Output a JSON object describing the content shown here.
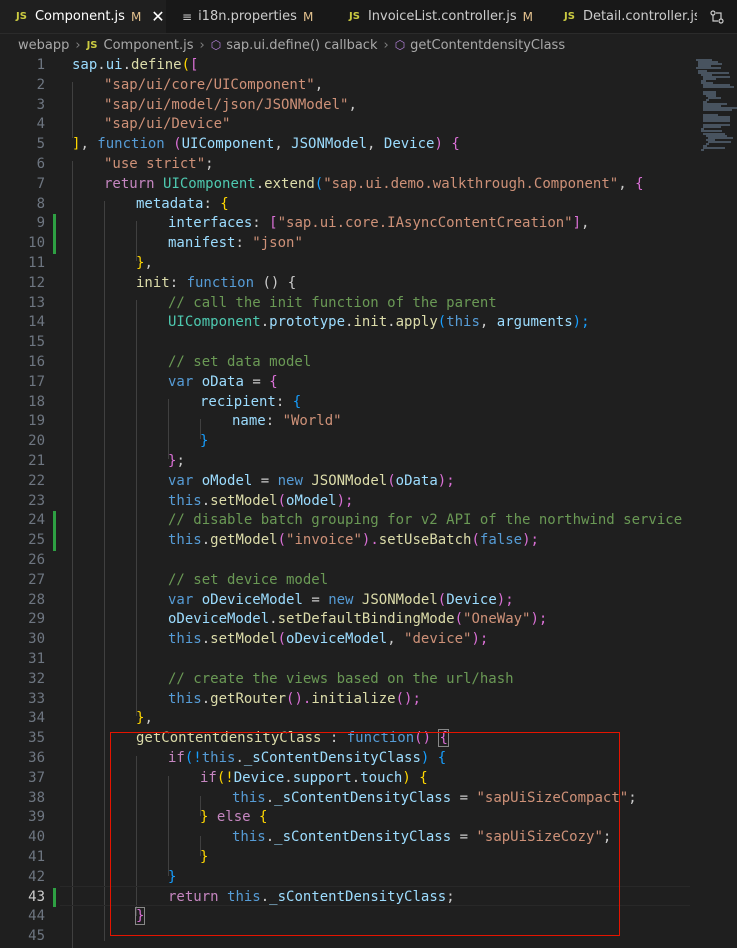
{
  "tabs": [
    {
      "icon": "JS",
      "label": "Component.js",
      "status": "M",
      "active": true,
      "close": "✕"
    },
    {
      "icon": "≡",
      "label": "i18n.properties",
      "status": "M",
      "active": false
    },
    {
      "icon": "JS",
      "label": "InvoiceList.controller.js",
      "status": "M",
      "active": false
    },
    {
      "icon": "JS",
      "label": "Detail.controller.js",
      "status": "",
      "active": false
    }
  ],
  "breadcrumb": {
    "folder": "webapp",
    "file_icon": "JS",
    "file": "Component.js",
    "symbol1": "sap.ui.define() callback",
    "symbol2": "getContentdensityClass"
  },
  "icons": {
    "tab_actions": "split-compare-icon",
    "cube": "method-cube-icon"
  },
  "editor": {
    "current_line": 43,
    "lines": [
      {
        "n": "1"
      },
      {
        "n": "2"
      },
      {
        "n": "3"
      },
      {
        "n": "4"
      },
      {
        "n": "5"
      },
      {
        "n": "6"
      },
      {
        "n": "7"
      },
      {
        "n": "8"
      },
      {
        "n": "9"
      },
      {
        "n": "10"
      },
      {
        "n": "11"
      },
      {
        "n": "12"
      },
      {
        "n": "13"
      },
      {
        "n": "14"
      },
      {
        "n": "15"
      },
      {
        "n": "16"
      },
      {
        "n": "17"
      },
      {
        "n": "18"
      },
      {
        "n": "19"
      },
      {
        "n": "20"
      },
      {
        "n": "21"
      },
      {
        "n": "22"
      },
      {
        "n": "23"
      },
      {
        "n": "24"
      },
      {
        "n": "25"
      },
      {
        "n": "26"
      },
      {
        "n": "27"
      },
      {
        "n": "28"
      },
      {
        "n": "29"
      },
      {
        "n": "30"
      },
      {
        "n": "31"
      },
      {
        "n": "32"
      },
      {
        "n": "33"
      },
      {
        "n": "34"
      },
      {
        "n": "35"
      },
      {
        "n": "36"
      },
      {
        "n": "37"
      },
      {
        "n": "38"
      },
      {
        "n": "39"
      },
      {
        "n": "40"
      },
      {
        "n": "41"
      },
      {
        "n": "42"
      },
      {
        "n": "43"
      },
      {
        "n": "44"
      },
      {
        "n": "45"
      }
    ],
    "code": {
      "l1": [
        "sap.ui.define(",
        "["
      ],
      "l2": "\"sap/ui/core/UIComponent\"",
      "l3": "\"sap/ui/model/json/JSONModel\"",
      "l4": "\"sap/ui/Device\"",
      "l5": [
        "]",
        ", ",
        "function",
        " (",
        "UIComponent",
        ", ",
        "JSONModel",
        ", ",
        "Device",
        ") ",
        "{"
      ],
      "l6": "\"use strict\"",
      "l7": [
        "return",
        " ",
        "UIComponent",
        ".",
        "extend",
        "(",
        "\"sap.ui.demo.walkthrough.Component\"",
        ", ",
        "{"
      ],
      "l8": [
        "metadata",
        ": ",
        "{"
      ],
      "l9": [
        "interfaces",
        ": ",
        "[",
        "\"sap.ui.core.IAsyncContentCreation\"",
        "]",
        ","
      ],
      "l10": [
        "manifest",
        ": ",
        "\"json\""
      ],
      "l11": [
        "}",
        ","
      ],
      "l12": [
        "init",
        ": ",
        "function",
        " ",
        "()",
        " ",
        "{"
      ],
      "l13": "// call the init function of the parent",
      "l14": [
        "UIComponent",
        ".",
        "prototype",
        ".",
        "init",
        ".",
        "apply",
        "(",
        "this",
        ", ",
        "arguments",
        ");"
      ],
      "l16": "// set data model",
      "l17": [
        "var",
        " ",
        "oData",
        " = ",
        "{"
      ],
      "l18": [
        "recipient",
        ": ",
        "{"
      ],
      "l19": [
        "name",
        ": ",
        "\"World\""
      ],
      "l20": "}",
      "l21": [
        "}",
        ";"
      ],
      "l22": [
        "var",
        " ",
        "oModel",
        " = ",
        "new",
        " ",
        "JSONModel",
        "(",
        "oData",
        ");"
      ],
      "l23": [
        "this",
        ".",
        "setModel",
        "(",
        "oModel",
        ");"
      ],
      "l24": "// disable batch grouping for v2 API of the northwind service",
      "l25": [
        "this",
        ".",
        "getModel",
        "(",
        "\"invoice\"",
        ").",
        "setUseBatch",
        "(",
        "false",
        ");"
      ],
      "l27": "// set device model",
      "l28": [
        "var",
        " ",
        "oDeviceModel",
        " = ",
        "new",
        " ",
        "JSONModel",
        "(",
        "Device",
        ");"
      ],
      "l29": [
        "oDeviceModel",
        ".",
        "setDefaultBindingMode",
        "(",
        "\"OneWay\"",
        ");"
      ],
      "l30": [
        "this",
        ".",
        "setModel",
        "(",
        "oDeviceModel",
        ", ",
        "\"device\"",
        ");"
      ],
      "l32": "// create the views based on the url/hash",
      "l33": [
        "this",
        ".",
        "getRouter",
        "().",
        "initialize",
        "();"
      ],
      "l34": [
        "}",
        ","
      ],
      "l35": [
        "getContentdensityClass",
        " : ",
        "function",
        "()",
        " ",
        "{"
      ],
      "l36": [
        "if",
        "(!",
        "this",
        ".",
        "_sContentDensityClass",
        ") ",
        "{"
      ],
      "l37": [
        "if",
        "(!",
        "Device",
        ".",
        "support",
        ".",
        "touch",
        ") ",
        "{"
      ],
      "l38": [
        "this",
        ".",
        "_sContentDensityClass",
        " = ",
        "\"sapUiSizeCompact\"",
        ";"
      ],
      "l39": [
        "}",
        " ",
        "else",
        " ",
        "{"
      ],
      "l40": [
        "this",
        ".",
        "_sContentDensityClass",
        " = ",
        "\"sapUiSizeCozy\"",
        ";"
      ],
      "l41": "}",
      "l42": "}",
      "l43": [
        "return",
        " ",
        "this",
        ".",
        "_sContentDensityClass",
        ";"
      ],
      "l44": "}"
    }
  },
  "colors": {
    "keyword": "#569cd6",
    "control": "#c586c0",
    "string": "#ce9178",
    "function": "#dcdcaa",
    "variable": "#9cdcfe",
    "class": "#4ec9b0",
    "comment": "#6a9955",
    "highlight_box": "#e51400"
  }
}
